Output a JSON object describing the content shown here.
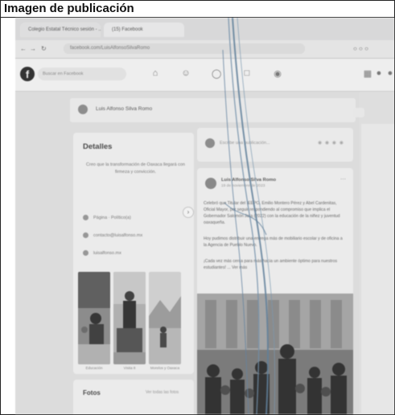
{
  "caption": "Imagen de publicación",
  "browser": {
    "tabs": [
      "Colegio Estatal Técnico sesión - ...",
      "(15) Facebook"
    ],
    "address": "facebook.com/LuisAlfonsoSilvaRomo"
  },
  "facebook": {
    "search_placeholder": "Buscar en Facebook",
    "logo": "f"
  },
  "profile": {
    "name": "Luis Alfonso Silva Romo"
  },
  "details": {
    "title": "Detalles",
    "bio": "Creo que la transformación de Oaxaca llegará con firmeza y convicción.",
    "page_line": "Página · Político(a)",
    "email": "contacto@luisalfonso.mx",
    "website": "luisalfonso.mx",
    "thumb_captions": [
      "Educación",
      "Visita 8",
      "Morelos y Oaxaca"
    ]
  },
  "fotos": {
    "title": "Fotos",
    "link": "Ver todas las fotos"
  },
  "composer": {
    "placeholder": "Escribe una publicación..."
  },
  "post": {
    "author": "Luis Alfonso Silva Romo",
    "date": "19 de noviembre de 2023",
    "paragraph1": "Celebró que Titular del IEEPO, Emilio Montero Pérez y Abel Cardenitas, Oficial Mayor, por seguir respondiendo al compromiso que implica el Gobernador Salomón Jara (2022) con la educación de la niñez y juventud oaxaqueña.",
    "paragraph2": "Hoy pudimos distribuir una entrega más de mobiliario escolar y de oficina a la Agencia de Pueblo Nuevo.",
    "paragraph3": "¡Cada vez más cerca para más hacia un ambiente óptimo para nuestros estudiantes! ... Ver más"
  }
}
